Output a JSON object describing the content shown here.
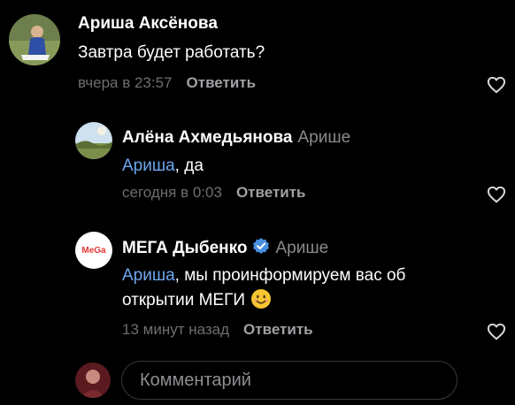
{
  "comments": [
    {
      "author": "Ариша Аксёнова",
      "text": "Завтра будет работать?",
      "time": "вчера в 23:57",
      "reply_label": "Ответить"
    },
    {
      "author": "Алёна Ахмедьянова",
      "reply_to": "Арише",
      "mention": "Ариша",
      "text": ", да",
      "time": "сегодня в 0:03",
      "reply_label": "Ответить"
    },
    {
      "author": "МЕГА Дыбенко",
      "reply_to": "Арише",
      "mention": "Ариша",
      "text": ", мы проинформируем вас об открытии МЕГИ",
      "time": "13 минут назад",
      "reply_label": "Ответить",
      "avatar_logo": "MeGa"
    }
  ],
  "composer": {
    "placeholder": "Комментарий"
  },
  "icons": {
    "like": "heart-outline-icon",
    "verified": "verified-check-icon",
    "emoji": "smiling-face-emoji-icon"
  },
  "colors": {
    "background": "#000000",
    "mention": "#6ea8f0",
    "verified": "#4a8fe0"
  }
}
